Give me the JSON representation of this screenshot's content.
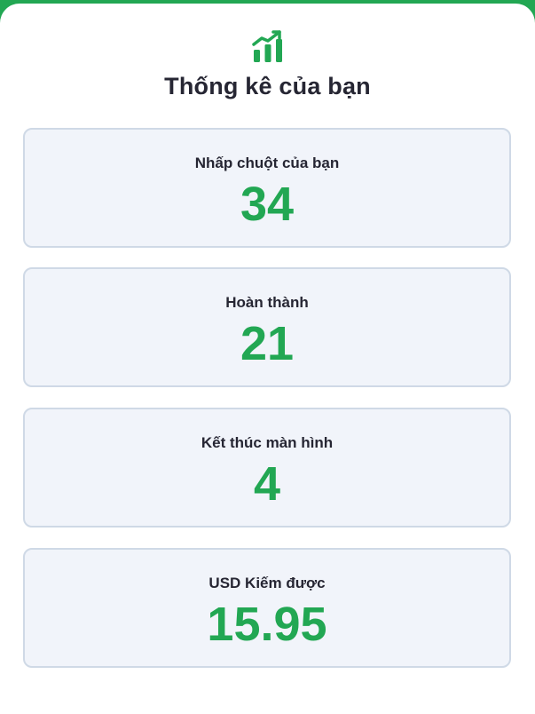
{
  "header": {
    "icon": "bar-chart-trend-icon",
    "title": "Thống kê của bạn"
  },
  "colors": {
    "accent": "#22a753",
    "card_bg": "#f1f4fa",
    "card_border": "#cfd9e6",
    "text": "#262633"
  },
  "stats": [
    {
      "label": "Nhấp chuột của bạn",
      "value": "34"
    },
    {
      "label": "Hoàn thành",
      "value": "21"
    },
    {
      "label": "Kết thúc màn hình",
      "value": "4"
    },
    {
      "label": "USD Kiếm được",
      "value": "15.95"
    }
  ]
}
